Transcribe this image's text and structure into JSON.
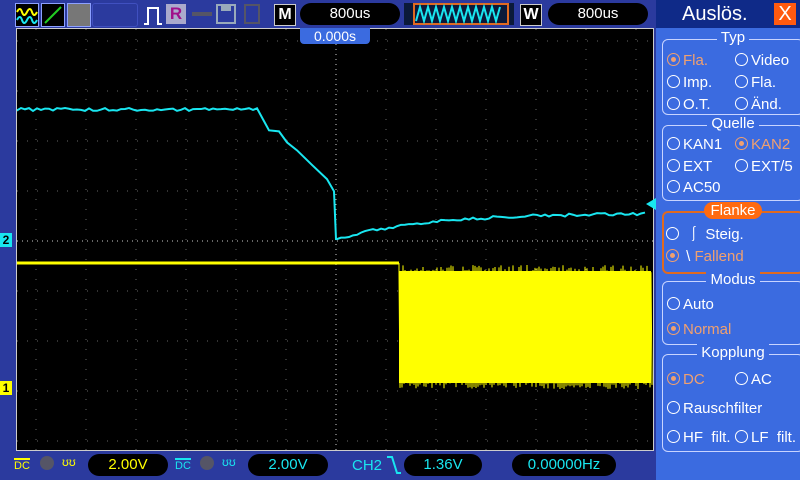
{
  "toolbar": {
    "run_state": "R",
    "m_label": "M",
    "timebase": "800us",
    "w_label": "W",
    "window_timebase": "800us",
    "trigger_pos": "0.000s"
  },
  "markers": {
    "ch1": "1",
    "ch2": "2"
  },
  "status": {
    "ch1_coupling": "DC",
    "ch1_scale": "2.00V",
    "ch2_coupling": "DC",
    "ch2_scale": "2.00V",
    "trig_source": "CH2",
    "trig_level": "1.36V",
    "frequency": "0.00000Hz"
  },
  "panel": {
    "title": "Auslös.",
    "close": "X",
    "typ": {
      "title": "Typ",
      "options": [
        "Fla.",
        "Video",
        "Imp.",
        "Fla.",
        "O.T.",
        "Änd."
      ]
    },
    "quelle": {
      "title": "Quelle",
      "options": [
        "KAN1",
        "KAN2",
        "EXT",
        "EXT/5",
        "AC50"
      ]
    },
    "flanke": {
      "title": "Flanke",
      "options": [
        "Steig.",
        "Fallend"
      ]
    },
    "modus": {
      "title": "Modus",
      "options": [
        "Auto",
        "Normal"
      ]
    },
    "kopplung": {
      "title": "Kopplung",
      "options": [
        "DC",
        "AC",
        "Rauschfilter",
        "HF  filt.",
        "LF  filt."
      ]
    }
  },
  "colors": {
    "ch1": "#ffff00",
    "ch2": "#19e6f0",
    "accent": "#ff6a10"
  }
}
